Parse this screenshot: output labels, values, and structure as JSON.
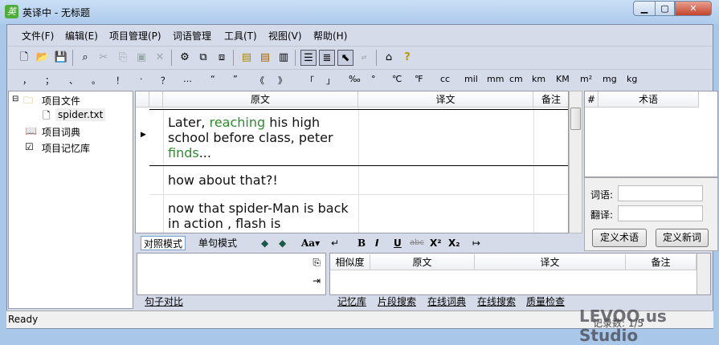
{
  "window": {
    "title": "英译中 - 无标题",
    "app_icon": "英"
  },
  "menu": [
    "文件(F)",
    "编辑(E)",
    "项目管理(P)",
    "词语管理",
    "工具(T)",
    "视图(V)",
    "帮助(H)"
  ],
  "toolbar_icons": [
    "new-file",
    "open-folder",
    "save",
    "find",
    "cut",
    "copy",
    "paste",
    "delete",
    "project-settings",
    "export",
    "import",
    "memory-add",
    "memory-remove",
    "clipboard-save",
    "view-compare",
    "view-single",
    "view-pointer",
    "swap-disabled",
    "home",
    "help"
  ],
  "punctuation": [
    "，",
    "；",
    "、",
    "。",
    "！",
    "·",
    "？",
    "…",
    "“",
    "”",
    "《",
    "》",
    "「",
    "」",
    "‰",
    "°",
    "℃",
    "℉",
    "cc",
    "mil",
    "mm",
    "cm",
    "km",
    "KM",
    "m²",
    "mg",
    "kg"
  ],
  "tree": {
    "root": "项目文件",
    "file": "spider.txt",
    "dict": "项目词典",
    "memory": "项目记忆库"
  },
  "grid": {
    "headers": {
      "source": "原文",
      "target": "译文",
      "note": "备注"
    },
    "rows": [
      {
        "source_parts": [
          "Later, ",
          "reaching",
          " his high school before class, peter ",
          "finds",
          "..."
        ]
      },
      {
        "source": "how about that?!"
      },
      {
        "source": "now that spider-Man is back in action , flash is"
      }
    ]
  },
  "terms": {
    "col_num": "#",
    "col_term": "术语",
    "word_label": "词语:",
    "trans_label": "翻译:",
    "word_value": "",
    "trans_value": "",
    "define_term": "定义术语",
    "define_word": "定义新词"
  },
  "format_bar": {
    "mode_compare": "对照模式",
    "mode_single": "单句模式",
    "font": "Aa▾",
    "bold": "B",
    "italic": "I",
    "underline": "U",
    "strike": "abc",
    "sup": "X²",
    "sub": "X₂",
    "enter": "↵",
    "spacer": "↦"
  },
  "memory": {
    "headers": [
      "相似度",
      "原文",
      "译文",
      "备注"
    ]
  },
  "tabs": {
    "left": [
      "句子对比"
    ],
    "right": [
      "记忆库",
      "片段搜索",
      "在线词典",
      "在线搜索",
      "质量检查"
    ]
  },
  "status": {
    "text": "Ready",
    "records": "记录数: 1/5",
    "watermark": "LEVOO.us Studio"
  }
}
